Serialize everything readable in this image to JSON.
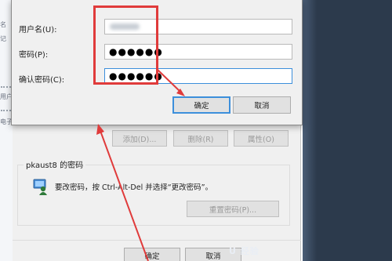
{
  "background_window": {
    "fragments": [
      "名",
      "记",
      "用户",
      "电子"
    ]
  },
  "properties_dialog": {
    "buttons": {
      "add": "添加(D)...",
      "remove": "删除(R)",
      "properties": "属性(O)"
    },
    "password_group": {
      "title": "pkaust8 的密码",
      "instruction": "要改密码，按 Ctrl-Alt-Del 并选择“更改密码”。",
      "reset_button": "重置密码(P)..."
    },
    "footer_buttons": {
      "ok": "确定",
      "cancel": "取消"
    }
  },
  "set_password_dialog": {
    "fields": {
      "username_label": "用户名(U):",
      "username_value": "pkaust8",
      "password_label": "密码(P):",
      "password_value": "●●●●●●",
      "confirm_label": "确认密码(C):",
      "confirm_value": "●●●●●●"
    },
    "buttons": {
      "ok": "确定",
      "cancel": "取消"
    }
  },
  "watermark": "ꓴ 经验",
  "colors": {
    "annotation_red": "#e03b3b",
    "focus_blue": "#3c8fdb",
    "dark_background": "#2c3a4c"
  }
}
